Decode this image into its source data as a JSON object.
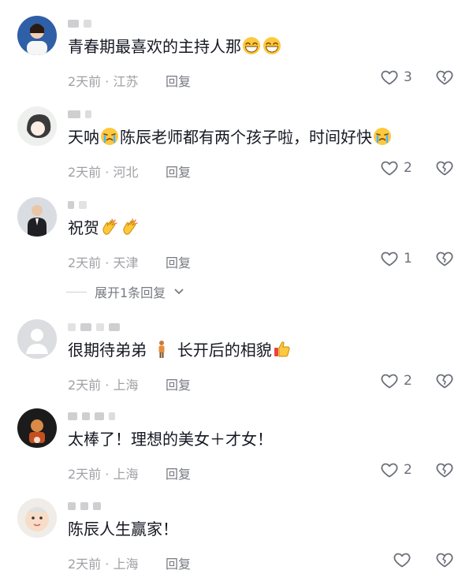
{
  "comments": [
    {
      "text": "青春期最喜欢的主持人那",
      "meta": "2天前 · 江苏",
      "reply": "回复",
      "likes": "3"
    },
    {
      "text_a": "天呐",
      "text_b": "陈辰老师都有两个孩子啦，时间好快",
      "meta": "2天前 · 河北",
      "reply": "回复",
      "likes": "2"
    },
    {
      "text": "祝贺",
      "meta": "2天前 · 天津",
      "reply": "回复",
      "likes": "1"
    },
    {
      "text_a": "很期待弟弟",
      "text_b": "长开后的相貌",
      "meta": "2天前 · 上海",
      "reply": "回复",
      "likes": "2"
    },
    {
      "text": "太棒了！理想的美女＋才女！",
      "meta": "2天前 · 上海",
      "reply": "回复",
      "likes": "2"
    },
    {
      "text": "陈辰人生赢家！",
      "meta": "2天前 · 上海",
      "reply": "回复",
      "likes": ""
    }
  ],
  "expand_label": "展开1条回复"
}
